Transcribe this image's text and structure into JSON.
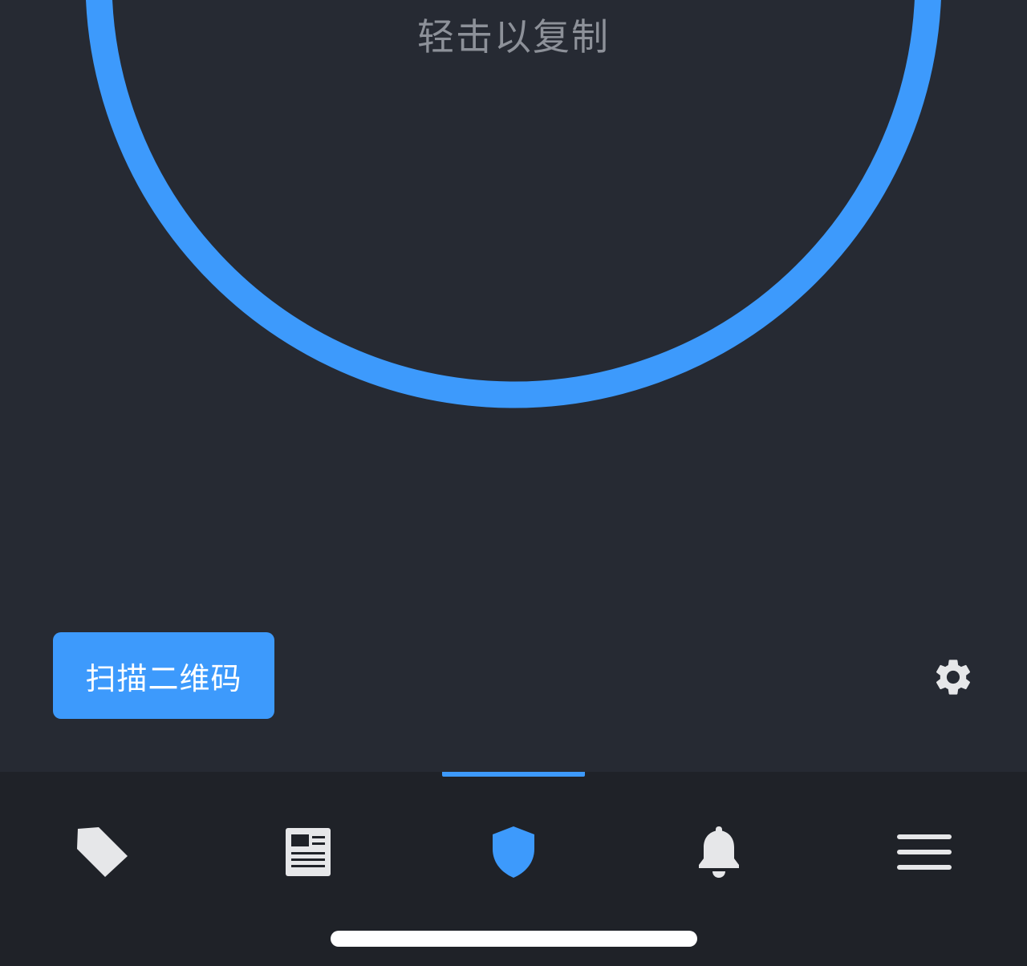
{
  "main": {
    "copy_hint": "轻击以复制",
    "countdown_remaining_fraction": 0.93,
    "ring_color": "#3d9afc",
    "ring_track_color": "#1c1f24",
    "scan_button_label": "扫描二维码",
    "settings_icon": "gear-icon"
  },
  "tabbar": {
    "active_tab": "shield",
    "accent_color": "#3d9afc",
    "tabs": [
      {
        "id": "tags",
        "icon": "tag-icon"
      },
      {
        "id": "news",
        "icon": "newspaper-icon"
      },
      {
        "id": "shield",
        "icon": "shield-icon"
      },
      {
        "id": "notifications",
        "icon": "bell-icon"
      },
      {
        "id": "menu",
        "icon": "hamburger-menu-icon"
      }
    ]
  }
}
